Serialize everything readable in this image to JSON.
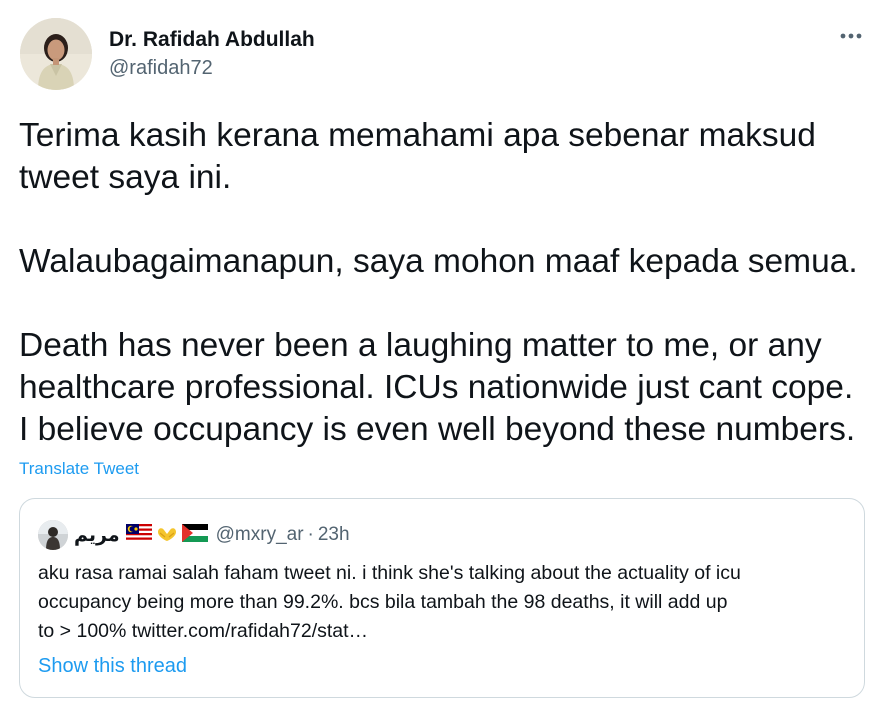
{
  "tweet": {
    "author": {
      "display_name": "Dr. Rafidah Abdullah",
      "handle": "@rafidah72",
      "avatar_icon": "profile-photo"
    },
    "more_icon": "more-dots-icon",
    "text_lines": [
      "Terima kasih kerana memahami apa sebenar maksud",
      "tweet saya ini.",
      "Walaubagaimanapun, saya mohon maaf kepada semua.",
      "Death has never been a laughing matter to me, or any",
      "healthcare professional. ICUs nationwide just cant cope.",
      "I believe occupancy is even well beyond these numbers."
    ],
    "translate_label": "Translate Tweet"
  },
  "quoted_tweet": {
    "display_name": "مريم",
    "flags": [
      "🇲🇾",
      "🫶",
      "🇵🇸"
    ],
    "handle": "@mxry_ar",
    "separator": "·",
    "time": "23h",
    "text_lines": [
      "aku rasa ramai salah faham tweet ni. i think she's talking about the actuality of icu",
      "occupancy being more than 99.2%. bcs bila tambah the 98 deaths, it will add up",
      "to > 100% twitter.com/rafidah72/stat…"
    ],
    "thread_label": "Show this thread"
  },
  "colors": {
    "text_primary": "#0f1419",
    "text_secondary": "#536471",
    "link": "#1d9bf0",
    "border": "#cfd9de"
  }
}
